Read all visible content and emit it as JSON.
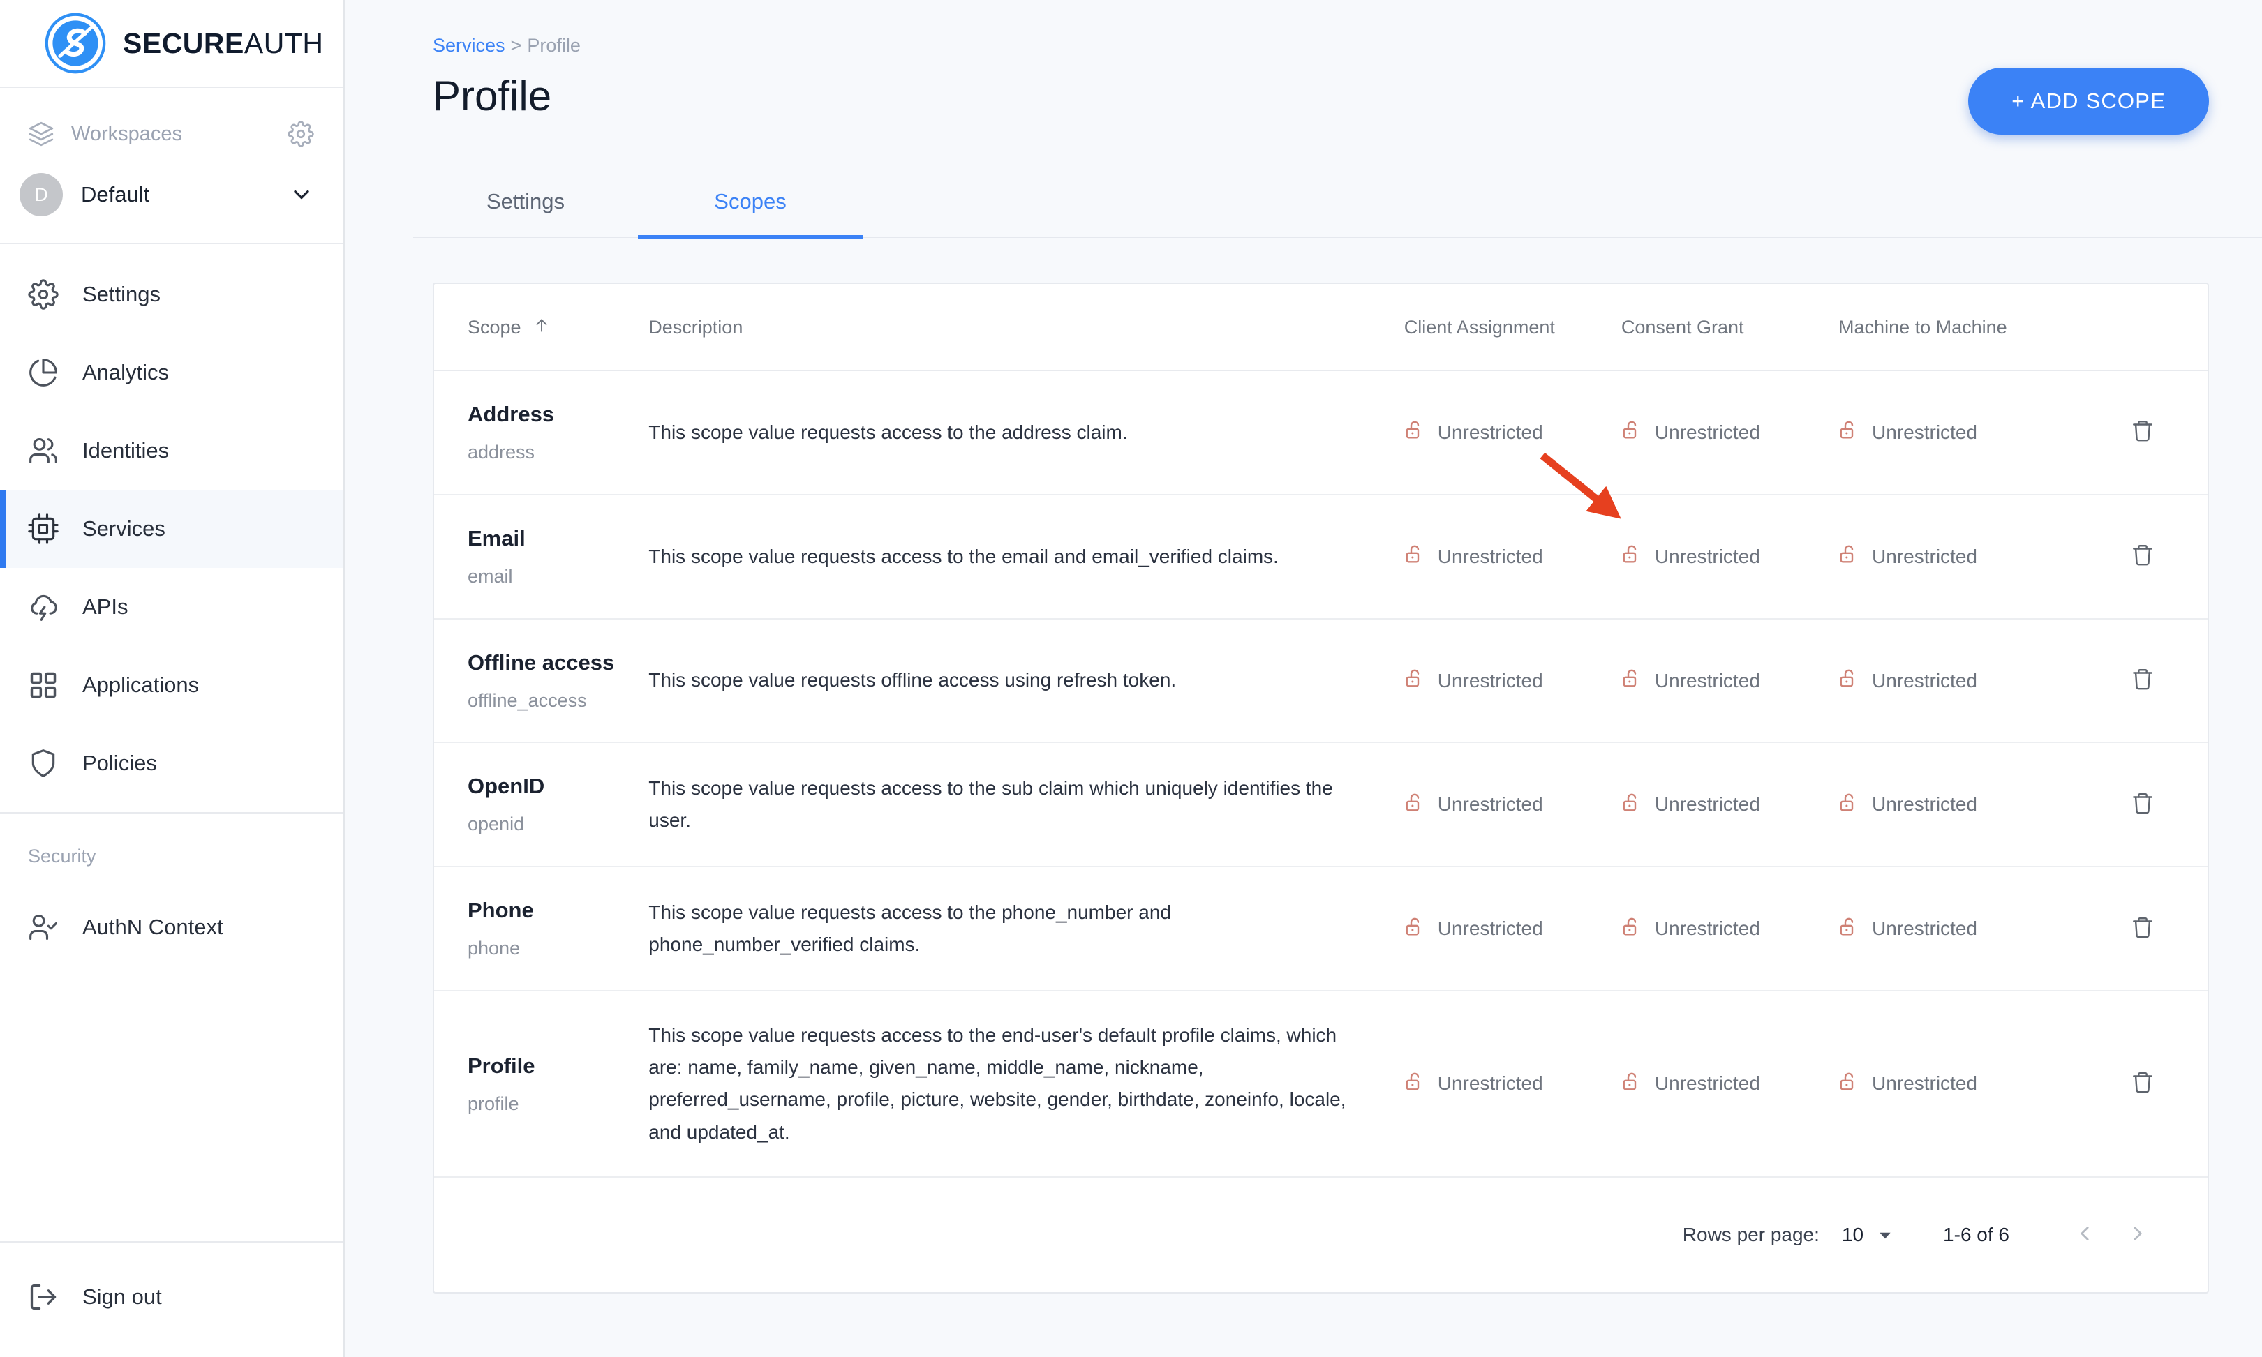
{
  "brand": {
    "name_bold": "SECURE",
    "name_light": "AUTH",
    "logo_color": "#2f90f5",
    "wordmark_color": "#101b2d"
  },
  "sidebar": {
    "workspaces": {
      "label": "Workspaces",
      "gear_icon": "gear-icon",
      "layers_icon": "layers-icon"
    },
    "workspace_selector": {
      "initial": "D",
      "name": "Default",
      "chevron_icon": "chevron-down-icon"
    },
    "nav_items": [
      {
        "label": "Settings",
        "icon": "gear-icon",
        "active": false
      },
      {
        "label": "Analytics",
        "icon": "pie-chart-icon",
        "active": false
      },
      {
        "label": "Identities",
        "icon": "users-icon",
        "active": false
      },
      {
        "label": "Services",
        "icon": "cpu-chip-icon",
        "active": true
      },
      {
        "label": "APIs",
        "icon": "cloud-bolt-icon",
        "active": false
      },
      {
        "label": "Applications",
        "icon": "grid-icon",
        "active": false
      },
      {
        "label": "Policies",
        "icon": "shield-icon",
        "active": false
      }
    ],
    "security_section": {
      "title": "Security",
      "items": [
        {
          "label": "AuthN Context",
          "icon": "user-check-icon"
        }
      ]
    },
    "sign_out": {
      "label": "Sign out",
      "icon": "logout-icon"
    }
  },
  "header": {
    "breadcrumb": {
      "parent": "Services",
      "separator": ">",
      "current": "Profile"
    },
    "title": "Profile",
    "add_button": "+ ADD SCOPE",
    "add_button_color": "#3b82f6"
  },
  "tabs": [
    {
      "label": "Settings",
      "active": false
    },
    {
      "label": "Scopes",
      "active": true
    }
  ],
  "table": {
    "columns": {
      "scope": "Scope",
      "scope_sort_icon": "arrow-up-icon",
      "description": "Description",
      "client_assignment": "Client Assignment",
      "consent_grant": "Consent Grant",
      "machine_to_machine": "Machine to Machine"
    },
    "permission_icon": "unlocked-padlock-icon",
    "permission_icon_color": "#cf8175",
    "delete_icon": "trash-icon",
    "rows": [
      {
        "name": "Address",
        "slug": "address",
        "description": "This scope value requests access to the address claim.",
        "client_assignment": "Unrestricted",
        "consent_grant": "Unrestricted",
        "machine_to_machine": "Unrestricted"
      },
      {
        "name": "Email",
        "slug": "email",
        "description": "This scope value requests access to the email and email_verified claims.",
        "client_assignment": "Unrestricted",
        "consent_grant": "Unrestricted",
        "machine_to_machine": "Unrestricted"
      },
      {
        "name": "Offline access",
        "slug": "offline_access",
        "description": "This scope value requests offline access using refresh token.",
        "client_assignment": "Unrestricted",
        "consent_grant": "Unrestricted",
        "machine_to_machine": "Unrestricted"
      },
      {
        "name": "OpenID",
        "slug": "openid",
        "description": "This scope value requests access to the sub claim which uniquely identifies the user.",
        "client_assignment": "Unrestricted",
        "consent_grant": "Unrestricted",
        "machine_to_machine": "Unrestricted"
      },
      {
        "name": "Phone",
        "slug": "phone",
        "description": "This scope value requests access to the phone_number and phone_number_verified claims.",
        "client_assignment": "Unrestricted",
        "consent_grant": "Unrestricted",
        "machine_to_machine": "Unrestricted"
      },
      {
        "name": "Profile",
        "slug": "profile",
        "description": "This scope value requests access to the end-user's default profile claims, which are: name, family_name, given_name, middle_name, nickname, preferred_username, profile, picture, website, gender, birthdate, zoneinfo, locale, and updated_at.",
        "client_assignment": "Unrestricted",
        "consent_grant": "Unrestricted",
        "machine_to_machine": "Unrestricted"
      }
    ]
  },
  "pagination": {
    "rows_per_page_label": "Rows per page:",
    "rows_per_page_value": "10",
    "caret_icon": "caret-down-icon",
    "range": "1-6 of 6",
    "prev_icon": "chevron-left-icon",
    "next_icon": "chevron-right-icon"
  },
  "annotation": {
    "type": "arrow",
    "color": "#e6401f",
    "points_to": "consent-grant-cell-row-email"
  }
}
